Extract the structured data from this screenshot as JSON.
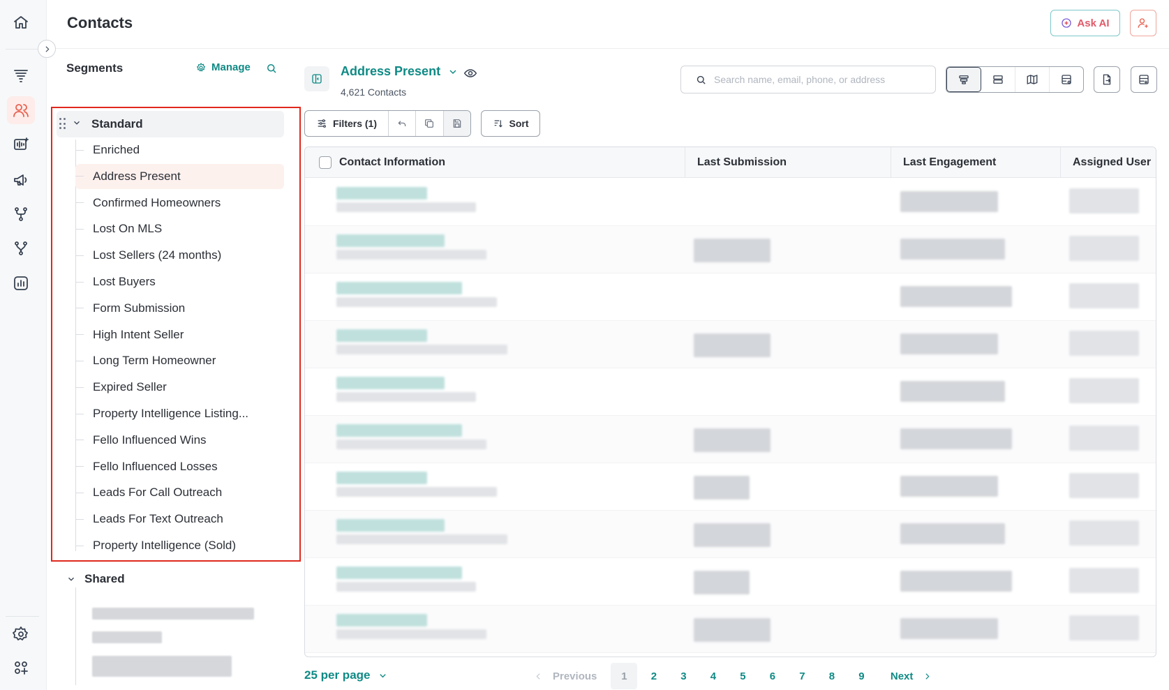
{
  "header": {
    "title": "Contacts",
    "ask_ai_label": "Ask AI"
  },
  "segments_panel": {
    "heading": "Segments",
    "manage_label": "Manage",
    "standard_group": {
      "label": "Standard",
      "items": [
        {
          "label": "Enriched"
        },
        {
          "label": "Address Present",
          "selected": true
        },
        {
          "label": "Confirmed Homeowners"
        },
        {
          "label": "Lost On MLS"
        },
        {
          "label": "Lost Sellers (24 months)"
        },
        {
          "label": "Lost Buyers"
        },
        {
          "label": "Form Submission"
        },
        {
          "label": "High Intent Seller"
        },
        {
          "label": "Long Term Homeowner"
        },
        {
          "label": "Expired Seller"
        },
        {
          "label": "Property Intelligence Listing..."
        },
        {
          "label": "Fello Influenced Wins"
        },
        {
          "label": "Fello Influenced Losses"
        },
        {
          "label": "Leads For Call Outreach"
        },
        {
          "label": "Leads For Text Outreach"
        },
        {
          "label": "Property Intelligence (Sold)"
        }
      ]
    },
    "shared_group": {
      "label": "Shared"
    }
  },
  "main": {
    "segment_name": "Address Present",
    "contact_count": "4,621 Contacts",
    "search": {
      "placeholder": "Search name, email, phone, or address",
      "value": ""
    },
    "filters_label": "Filters (1)",
    "sort_label": "Sort"
  },
  "table": {
    "columns": [
      "Contact Information",
      "Last Submission",
      "Last Engagement",
      "Assigned User"
    ]
  },
  "pagination": {
    "per_page_label": "25 per page",
    "previous_label": "Previous",
    "next_label": "Next",
    "pages": [
      "1",
      "2",
      "3",
      "4",
      "5",
      "6",
      "7",
      "8",
      "9"
    ],
    "current_page": "1"
  },
  "colors": {
    "brand_teal": "#0f8a85",
    "accent_coral": "#e8614f",
    "highlight_red": "#e0281c"
  }
}
